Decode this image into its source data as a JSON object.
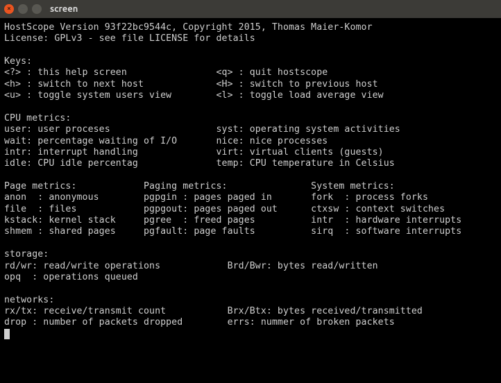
{
  "window": {
    "title": "screen",
    "close_label": "×",
    "min_label": "–",
    "max_label": "□"
  },
  "header": {
    "line1": "HostScope Version 93f22bc9544c, Copyright 2015, Thomas Maier-Komor",
    "line2": "License: GPLv3 - see file LICENSE for details"
  },
  "keys": {
    "title": "Keys:",
    "rows": [
      {
        "k1": "<?>",
        "d1": "this help screen",
        "k2": "<q>",
        "d2": "quit hostscope"
      },
      {
        "k1": "<h>",
        "d1": "switch to next host",
        "k2": "<H>",
        "d2": "switch to previous host"
      },
      {
        "k1": "<u>",
        "d1": "toggle system users view",
        "k2": "<l>",
        "d2": "toggle load average view"
      }
    ]
  },
  "cpu": {
    "title": "CPU metrics:",
    "rows": [
      {
        "k1": "user",
        "d1": "user proceses",
        "k2": "syst",
        "d2": "operating system activities"
      },
      {
        "k1": "wait",
        "d1": "percentage waiting of I/O",
        "k2": "nice",
        "d2": "nice processes"
      },
      {
        "k1": "intr",
        "d1": "interrupt handling",
        "k2": "virt",
        "d2": "virtual clients (guests)"
      },
      {
        "k1": "idle",
        "d1": "CPU idle percentag",
        "k2": "temp",
        "d2": "CPU temperature in Celsius"
      }
    ]
  },
  "page_metrics": {
    "title": "Page metrics:",
    "rows": [
      {
        "k": "anon",
        "d": "anonymous"
      },
      {
        "k": "file",
        "d": "files"
      },
      {
        "k": "kstack",
        "d": "kernel stack"
      },
      {
        "k": "shmem",
        "d": "shared pages"
      }
    ]
  },
  "paging_metrics": {
    "title": "Paging metrics:",
    "rows": [
      {
        "k": "pgpgin",
        "d": "pages paged in"
      },
      {
        "k": "pgpgout",
        "d": "pages paged out"
      },
      {
        "k": "pgree",
        "d": "freed pages"
      },
      {
        "k": "pgfault",
        "d": "page faults"
      }
    ]
  },
  "system_metrics": {
    "title": "System metrics:",
    "rows": [
      {
        "k": "fork",
        "d": "process forks"
      },
      {
        "k": "ctxsw",
        "d": "context switches"
      },
      {
        "k": "intr",
        "d": "hardware interrupts"
      },
      {
        "k": "sirq",
        "d": "software interrupts"
      }
    ]
  },
  "storage": {
    "title": "storage:",
    "rows": [
      {
        "k1": "rd/wr",
        "d1": "read/write operations",
        "k2": "Brd/Bwr",
        "d2": "bytes read/written"
      },
      {
        "k1": "opq",
        "d1": "operations queued",
        "k2": "",
        "d2": ""
      }
    ]
  },
  "networks": {
    "title": "networks:",
    "rows": [
      {
        "k1": "rx/tx",
        "d1": "receive/transmit count",
        "k2": "Brx/Btx",
        "d2": "bytes received/transmitted"
      },
      {
        "k1": "drop",
        "d1": "number of packets dropped",
        "k2": "errs",
        "d2": "nummer of broken packets"
      }
    ]
  }
}
